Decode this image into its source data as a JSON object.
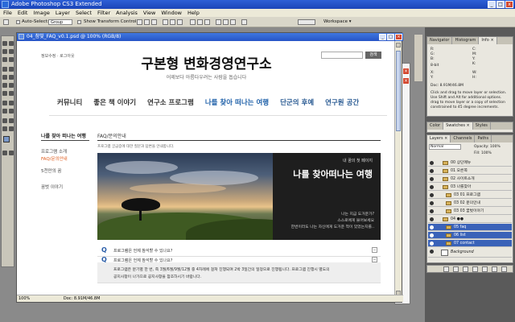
{
  "app": {
    "title": "Adobe Photoshop CS3 Extended",
    "window_buttons": [
      "_",
      "□",
      "x"
    ]
  },
  "menu": [
    "File",
    "Edit",
    "Image",
    "Layer",
    "Select",
    "Filter",
    "Analysis",
    "View",
    "Window",
    "Help"
  ],
  "options": {
    "auto_select_label": "Auto-Select:",
    "auto_select_value": "Group",
    "show_transform_label": "Show Transform Controls",
    "workspace_label": "Workspace ▾"
  },
  "document": {
    "title": "04_참빛_FAQ_v0.1.psd @ 100% (RGB/8)",
    "zoom": "100%",
    "doc_size": "Doc: 8.91M/46.8M"
  },
  "site": {
    "top_links": "정보수정 · 로그아웃",
    "search_button": "검색",
    "title": "구본형 변화경영연구소",
    "subtitle": "어제보다 아름다우려는 사람을 돕습니다",
    "nav": [
      "커뮤니티",
      "좋은 책 이야기",
      "연구소 프로그램",
      "나를 찾아 떠나는 여행",
      "단군의 후예",
      "연구원 공간"
    ],
    "lnb_title": "나를 찾아 떠나는 여행",
    "lnb_items": [
      "프로그램 소개",
      "FAQ/문의안내",
      "5천만의 꿈",
      "꿈벗 이야기"
    ],
    "breadcrumb": "FAQ/문의안내",
    "intro": "프로그램 궁금증에 대한 질문과 답변을 안내합니다.",
    "banner": {
      "small": "내 꿈의 첫 페이지",
      "title": "나를 찾아떠나는 여행",
      "lines": [
        "나는 지금 도거운가?",
        "스스로에게 물어보세요",
        "한번이라도 나는 자신에게 도거운 적이 있었는지를.."
      ]
    },
    "faq": [
      {
        "q": "Q",
        "text": "프로그램은 언제 참석할 수 있나요?",
        "toggle": "−"
      },
      {
        "q": "Q",
        "text": "프로그램은 언제 참석할 수 있나요?",
        "toggle": "−"
      }
    ],
    "answer": [
      "프로그램은 분기별 한 번, 즉 3월/6월/9월/12월 중 4차례에 걸쳐 진행되며 2박 3일간의 일정으로 진행됩니다. 프로그램 진행시 별도의",
      "공지사항이 나가므로 공지사항을 참조하시기 바랍니다."
    ]
  },
  "panels": {
    "info_tabs": [
      "Navigator",
      "Histogram",
      "Info ×"
    ],
    "info_lines": [
      "R:",
      "G:",
      "B:",
      "8-bit",
      "X:",
      "Y:",
      "C:",
      "M:",
      "Y:",
      "K:",
      "W:",
      "H:"
    ],
    "info_doc": "Doc: 8.91M/46.8M",
    "info_hint": "Click and drag to move layer or selection. Use Shift and Alt for additional options. drag to move layer or a copy of selection constrained to 45 degree increments.",
    "color_tabs": [
      "Color",
      "Swatches ×",
      "Styles"
    ],
    "layer_tabs": [
      "Layers ×",
      "Channels",
      "Paths"
    ],
    "blend_mode": "Normal",
    "opacity": "Opacity: 100%",
    "fill": "Fill: 100%",
    "layers": [
      {
        "name": "00 상단메뉴",
        "selected": false
      },
      {
        "name": "01 오른쪽",
        "selected": false
      },
      {
        "name": "02 사이트소개",
        "selected": false
      },
      {
        "name": "03 나를찾아",
        "selected": false
      },
      {
        "name": "03 01 프로그램",
        "selected": false
      },
      {
        "name": "03 02 문의안내",
        "selected": false
      },
      {
        "name": "03 03 꿈벗이야기",
        "selected": false
      },
      {
        "name": "04 ●●",
        "selected": false
      },
      {
        "name": "05 faq",
        "selected": true
      },
      {
        "name": "06 list",
        "selected": true
      },
      {
        "name": "07 contact",
        "selected": true
      },
      {
        "name": "Background",
        "selected": false
      }
    ]
  },
  "colors": {
    "title_blue": "#1b45b8",
    "nav_active": "#1d5fa8",
    "lnb_active": "#e05a1a",
    "layer_selected": "#3a62b8"
  }
}
